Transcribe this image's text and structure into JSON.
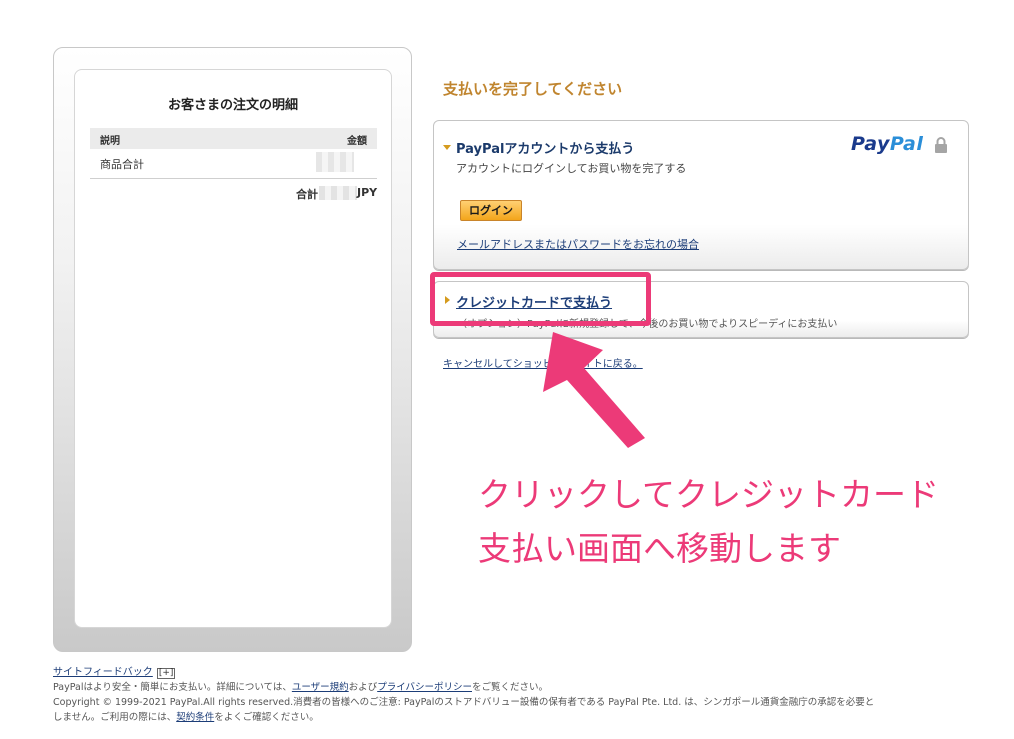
{
  "order": {
    "title": "お客さまの注文の明細",
    "col_description": "説明",
    "col_amount": "金額",
    "subtotal_label": "商品合計",
    "total_label": "合計",
    "currency": "JPY"
  },
  "main": {
    "heading": "支払いを完了してください",
    "account_option": {
      "title": "PayPalアカウントから支払う",
      "subtitle": "アカウントにログインしてお買い物を完了する",
      "login_button": "ログイン",
      "forgot_link": "メールアドレスまたはパスワードをお忘れの場合"
    },
    "logo": {
      "part1": "Pay",
      "part2": "Pal"
    },
    "card_option": {
      "title": "クレジットカードで支払う",
      "subtitle": "（オプション）PayPalに新規登録して、今後のお買い物でよりスピーディにお支払い"
    },
    "cancel_link": "キャンセルしてショッピングサイトに戻る。"
  },
  "annotation": {
    "text": "クリックしてクレジットカード支払い画面へ移動します",
    "color": "#ec3a78"
  },
  "footer": {
    "feedback_link": "サイトフィードバック",
    "feedback_toggle": "[+]",
    "line1_prefix": "PayPalはより安全・簡単にお支払い。詳細については、",
    "terms_link": "ユーザー規約",
    "line1_mid": "および",
    "privacy_link": "プライバシーポリシー",
    "line1_suffix": "をご覧ください。",
    "line2": "Copyright © 1999-2021 PayPal.All rights reserved.消費者の皆様へのご注意: PayPalのストアドバリュー設備の保有者である PayPal Pte. Ltd. は、シンガポール通貨金融庁の承認を必要と",
    "line3_prefix": "しません。ご利用の際には、",
    "contract_link": "契約条件",
    "line3_suffix": "をよくご確認ください。"
  },
  "colors": {
    "heading": "#c0852f",
    "link": "#1c3d78",
    "button": "#f3a51b",
    "logo_dark": "#1a3a8c",
    "logo_light": "#2a8ed8"
  },
  "icons": [
    "chevron-down-icon",
    "chevron-right-icon",
    "lock-icon",
    "arrow-annotation-icon"
  ]
}
